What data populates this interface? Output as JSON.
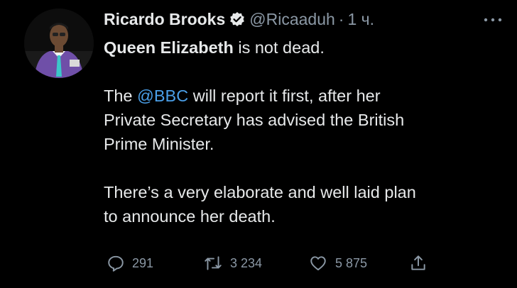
{
  "tweet": {
    "author": {
      "display_name": "Ricardo Brooks",
      "handle": "@Ricaaduh",
      "separator": "·",
      "time": "1 ч.",
      "verified": true,
      "avatar_icon": "profile-photo"
    },
    "more_icon": "ellipsis-icon",
    "body": {
      "p1_bold": "Queen Elizabeth",
      "p1_rest": " is not dead.",
      "p2_lead": "The ",
      "p2_mention": "@BBC",
      "p2_line1_rest": " will report it first, after her",
      "p2_line2": "Private Secretary has advised the British",
      "p2_line3": "Prime Minister.",
      "p3_line1": "There’s a very elaborate and well laid plan",
      "p3_line2": "to announce her death."
    },
    "actions": {
      "replies": "291",
      "retweets": "3 234",
      "likes": "5 875"
    }
  },
  "colors": {
    "background": "#000000",
    "text": "#e7e9ea",
    "muted": "#8b98a5",
    "link": "#4a9fe8",
    "verified_badge": "#e7e9ea"
  }
}
